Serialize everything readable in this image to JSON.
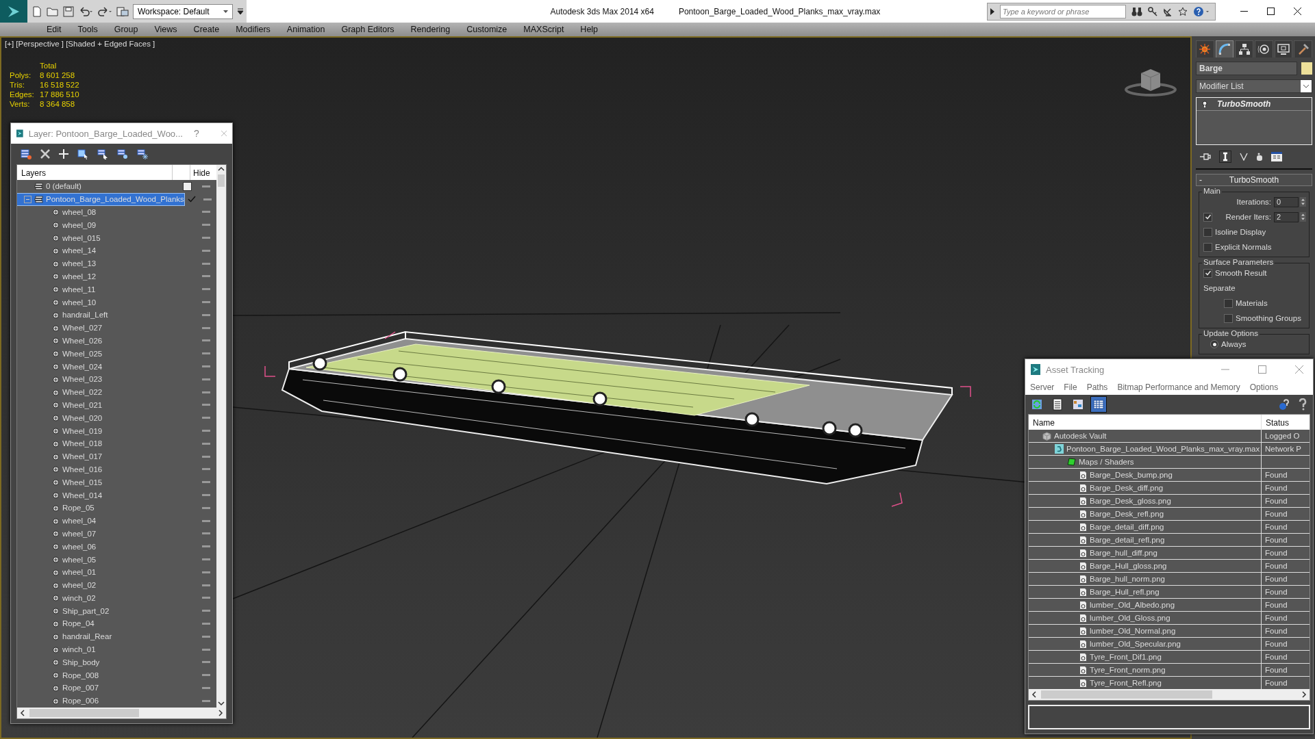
{
  "title_bar": {
    "workspace": "Workspace: Default",
    "app_title": "Autodesk 3ds Max  2014 x64",
    "file_title": "Pontoon_Barge_Loaded_Wood_Planks_max_vray.max",
    "search": {
      "placeholder": "Type a keyword or phrase"
    }
  },
  "menu": [
    "Edit",
    "Tools",
    "Group",
    "Views",
    "Create",
    "Modifiers",
    "Animation",
    "Graph Editors",
    "Rendering",
    "Customize",
    "MAXScript",
    "Help"
  ],
  "viewport": {
    "label": "[+] [Perspective ] [Shaded + Edged Faces ]",
    "stats_header": "Total",
    "stats": [
      {
        "label": "Polys:",
        "value": "8 601 258"
      },
      {
        "label": "Tris:",
        "value": "16 518 522"
      },
      {
        "label": "Edges:",
        "value": "17 886 510"
      },
      {
        "label": "Verts:",
        "value": "8 364 858"
      }
    ]
  },
  "layer_window": {
    "title": "Layer: Pontoon_Barge_Loaded_Woo...",
    "help": "?",
    "columns": [
      "Layers",
      "Hide"
    ],
    "layers": [
      {
        "name": "0 (default)",
        "selected": false,
        "current": false
      },
      {
        "name": "Pontoon_Barge_Loaded_Wood_Planks",
        "selected": true,
        "current": true,
        "expanded": true,
        "children": [
          {
            "name": "wheel_08",
            "selected": false
          },
          {
            "name": "wheel_09",
            "selected": false
          },
          {
            "name": "wheel_015",
            "selected": false
          },
          {
            "name": "wheel_14",
            "selected": false
          },
          {
            "name": "wheel_13",
            "selected": false
          },
          {
            "name": "wheel_12",
            "selected": false
          },
          {
            "name": "wheel_11",
            "selected": false
          },
          {
            "name": "wheel_10",
            "selected": false
          },
          {
            "name": "handrail_Left",
            "selected": false
          },
          {
            "name": "Wheel_027",
            "selected": false
          },
          {
            "name": "Wheel_026",
            "selected": false
          },
          {
            "name": "Wheel_025",
            "selected": false
          },
          {
            "name": "Wheel_024",
            "selected": false
          },
          {
            "name": "Wheel_023",
            "selected": false
          },
          {
            "name": "Wheel_022",
            "selected": false
          },
          {
            "name": "Wheel_021",
            "selected": false
          },
          {
            "name": "Wheel_020",
            "selected": false
          },
          {
            "name": "Wheel_019",
            "selected": false
          },
          {
            "name": "Wheel_018",
            "selected": false
          },
          {
            "name": "Wheel_017",
            "selected": false
          },
          {
            "name": "Wheel_016",
            "selected": false
          },
          {
            "name": "Wheel_015",
            "selected": false
          },
          {
            "name": "Wheel_014",
            "selected": false
          },
          {
            "name": "Rope_05",
            "selected": false
          },
          {
            "name": "wheel_04",
            "selected": false
          },
          {
            "name": "wheel_07",
            "selected": false
          },
          {
            "name": "wheel_06",
            "selected": false
          },
          {
            "name": "wheel_05",
            "selected": false
          },
          {
            "name": "wheel_01",
            "selected": false
          },
          {
            "name": "wheel_02",
            "selected": false
          },
          {
            "name": "winch_02",
            "selected": false
          },
          {
            "name": "Ship_part_02",
            "selected": false
          },
          {
            "name": "Rope_04",
            "selected": false
          },
          {
            "name": "handrail_Rear",
            "selected": false
          },
          {
            "name": "winch_01",
            "selected": false
          },
          {
            "name": "Ship_body",
            "selected": false
          },
          {
            "name": "Rope_008",
            "selected": false
          },
          {
            "name": "Rope_007",
            "selected": false
          },
          {
            "name": "Rope_006",
            "selected": false
          }
        ]
      }
    ]
  },
  "command_panel": {
    "tabs": [
      {
        "kind": "create",
        "selected": false
      },
      {
        "kind": "modify",
        "selected": true
      },
      {
        "kind": "hierarchy",
        "selected": false
      },
      {
        "kind": "motion",
        "selected": false
      },
      {
        "kind": "display",
        "selected": false
      },
      {
        "kind": "utilities",
        "selected": false
      }
    ],
    "object_name": "Barge",
    "modifier_list": "Modifier List",
    "stack": [
      "TurboSmooth"
    ],
    "rollout": {
      "title": "TurboSmooth",
      "collapse": "-",
      "groups": [
        {
          "title": "Main",
          "items": [
            {
              "kind": "spinner",
              "label": "Iterations:",
              "value": "0"
            },
            {
              "kind": "check_spinner",
              "label": "Render Iters:",
              "value": "2",
              "checked": true
            },
            {
              "kind": "checkbox",
              "label": "Isoline Display",
              "checked": false
            },
            {
              "kind": "checkbox",
              "label": "Explicit Normals",
              "checked": false
            }
          ]
        },
        {
          "title": "Surface Parameters",
          "items": [
            {
              "kind": "checkbox",
              "label": "Smooth Result",
              "checked": true
            },
            {
              "kind": "text",
              "label": "Separate"
            },
            {
              "kind": "subcheckbox",
              "label": "Materials",
              "checked": false
            },
            {
              "kind": "subcheckbox",
              "label": "Smoothing Groups",
              "checked": false
            }
          ]
        },
        {
          "title": "Update Options",
          "items": [
            {
              "kind": "radio",
              "label": "Always",
              "selected": true
            }
          ]
        }
      ]
    }
  },
  "asset_window": {
    "title": "Asset Tracking",
    "menu": [
      "Server",
      "File",
      "Paths",
      "Bitmap Performance and Memory",
      "Options"
    ],
    "toolbar": [
      {
        "kind": "refresh",
        "selected": false
      },
      {
        "kind": "list",
        "selected": false
      },
      {
        "kind": "thumbnails",
        "selected": false
      },
      {
        "kind": "table",
        "selected": true
      }
    ],
    "columns": [
      "Name",
      "Status"
    ],
    "tree": [
      {
        "kind": "vault",
        "name": "Autodesk Vault",
        "status": "Logged O",
        "children": [
          {
            "kind": "max",
            "name": "Pontoon_Barge_Loaded_Wood_Planks_max_vray.max",
            "status": "Network P",
            "children": [
              {
                "kind": "folder",
                "name": "Maps / Shaders",
                "children": [
                  {
                    "kind": "bitmap",
                    "name": "Barge_Desk_bump.png",
                    "status": "Found"
                  },
                  {
                    "kind": "bitmap",
                    "name": "Barge_Desk_diff.png",
                    "status": "Found"
                  },
                  {
                    "kind": "bitmap",
                    "name": "Barge_Desk_gloss.png",
                    "status": "Found"
                  },
                  {
                    "kind": "bitmap",
                    "name": "Barge_Desk_refl.png",
                    "status": "Found"
                  },
                  {
                    "kind": "bitmap",
                    "name": "Barge_detail_diff.png",
                    "status": "Found"
                  },
                  {
                    "kind": "bitmap",
                    "name": "Barge_detail_refl.png",
                    "status": "Found"
                  },
                  {
                    "kind": "bitmap",
                    "name": "Barge_hull_diff.png",
                    "status": "Found"
                  },
                  {
                    "kind": "bitmap",
                    "name": "Barge_Hull_gloss.png",
                    "status": "Found"
                  },
                  {
                    "kind": "bitmap",
                    "name": "Barge_hull_norm.png",
                    "status": "Found"
                  },
                  {
                    "kind": "bitmap",
                    "name": "Barge_Hull_refl.png",
                    "status": "Found"
                  },
                  {
                    "kind": "bitmap",
                    "name": "lumber_Old_Albedo.png",
                    "status": "Found"
                  },
                  {
                    "kind": "bitmap",
                    "name": "lumber_Old_Gloss.png",
                    "status": "Found"
                  },
                  {
                    "kind": "bitmap",
                    "name": "lumber_Old_Normal.png",
                    "status": "Found"
                  },
                  {
                    "kind": "bitmap",
                    "name": "lumber_Old_Specular.png",
                    "status": "Found"
                  },
                  {
                    "kind": "bitmap",
                    "name": "Tyre_Front_Dif1.png",
                    "status": "Found"
                  },
                  {
                    "kind": "bitmap",
                    "name": "Tyre_Front_norm.png",
                    "status": "Found"
                  },
                  {
                    "kind": "bitmap",
                    "name": "Tyre_Front_Refl.png",
                    "status": "Found"
                  }
                ]
              }
            ]
          }
        ]
      }
    ]
  }
}
